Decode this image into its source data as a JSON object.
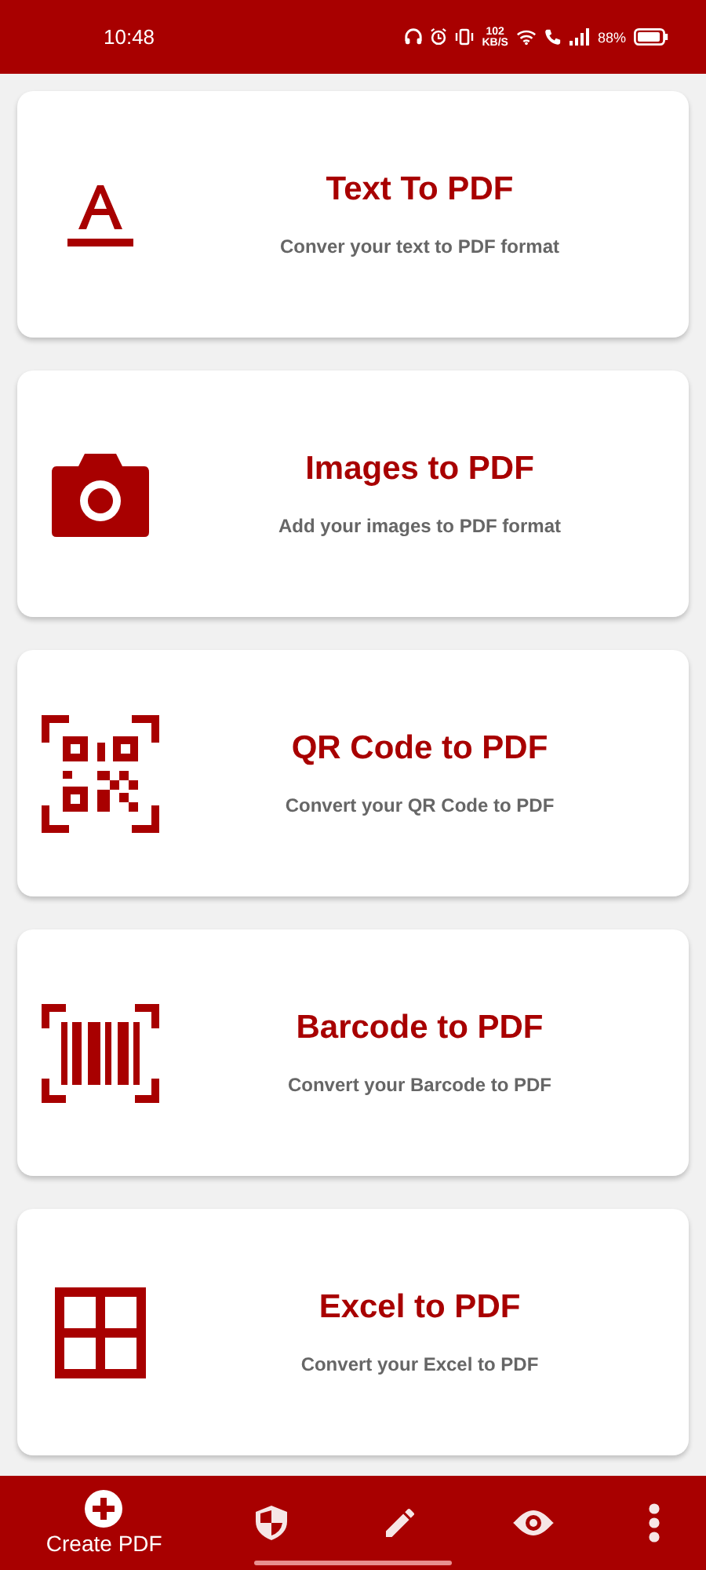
{
  "status_bar": {
    "time": "10:48",
    "speed": "102",
    "speed_unit": "KB/S",
    "battery": "88%"
  },
  "cards": [
    {
      "kind": "text",
      "title": "Text To PDF",
      "subtitle": "Conver your text to PDF format"
    },
    {
      "kind": "camera",
      "title": "Images to PDF",
      "subtitle": "Add your images to PDF format"
    },
    {
      "kind": "qr",
      "title": "QR Code to PDF",
      "subtitle": "Convert your QR Code to PDF"
    },
    {
      "kind": "barcode",
      "title": "Barcode to PDF",
      "subtitle": "Convert your Barcode to PDF"
    },
    {
      "kind": "grid",
      "title": "Excel to PDF",
      "subtitle": "Convert your Excel to PDF"
    }
  ],
  "nav": [
    {
      "kind": "create",
      "label": "Create PDF",
      "selected": true
    },
    {
      "kind": "shield",
      "selected": false
    },
    {
      "kind": "pencil",
      "selected": false
    },
    {
      "kind": "eye",
      "selected": false
    },
    {
      "kind": "more",
      "selected": false
    }
  ]
}
